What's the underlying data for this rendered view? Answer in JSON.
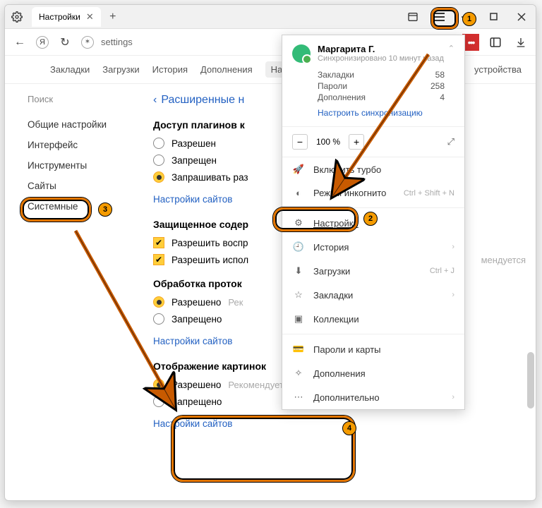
{
  "tab": {
    "title": "Настройки"
  },
  "address": {
    "text": "settings",
    "page_title": "Настройки"
  },
  "linkbar": {
    "bookmarks": "Закладки",
    "downloads": "Загрузки",
    "history": "История",
    "addons": "Дополнения",
    "settings": "Настр",
    "devices": "устройства"
  },
  "sidebar": {
    "search": "Поиск",
    "items": [
      "Общие настройки",
      "Интерфейс",
      "Инструменты",
      "Сайты",
      "Системные"
    ]
  },
  "content": {
    "back": "Расширенные н",
    "sec1": {
      "title": "Доступ плагинов к",
      "opt_allow": "Разрешен",
      "opt_deny": "Запрещен",
      "opt_ask": "Запрашивать раз",
      "link": "Настройки сайтов"
    },
    "sec2": {
      "title": "Защищенное содер",
      "chk1": "Разрешить воспр",
      "chk2": "Разрешить испол"
    },
    "sec3": {
      "title": "Обработка проток",
      "opt_allow": "Разрешено",
      "hint": "Рек",
      "opt_deny": "Запрещено",
      "link": "Настройки сайтов"
    },
    "sec4": {
      "title": "Отображение картинок",
      "opt_allow": "Разрешено",
      "hint": "Рекомендуется",
      "opt_deny": "Запрещено",
      "link": "Настройки сайтов"
    },
    "partial_hint": "мендуется"
  },
  "menu": {
    "user_name": "Маргарита Г.",
    "user_sync": "Синхронизировано 10 минут назад",
    "stats": {
      "bookmarks_label": "Закладки",
      "bookmarks_val": "58",
      "passwords_label": "Пароли",
      "passwords_val": "258",
      "addons_label": "Дополнения",
      "addons_val": "4"
    },
    "sync_link": "Настроить синхронизацию",
    "zoom": "100 %",
    "items": {
      "turbo": "Включить турбо",
      "incognito": "Режим инкогнито",
      "incognito_sc": "Ctrl + Shift + N",
      "settings": "Настройки",
      "history": "История",
      "downloads": "Загрузки",
      "downloads_sc": "Ctrl + J",
      "bookmarks": "Закладки",
      "collections": "Коллекции",
      "passwords": "Пароли и карты",
      "addons": "Дополнения",
      "more": "Дополнительно"
    }
  },
  "badges": {
    "b1": "1",
    "b2": "2",
    "b3": "3",
    "b4": "4"
  }
}
